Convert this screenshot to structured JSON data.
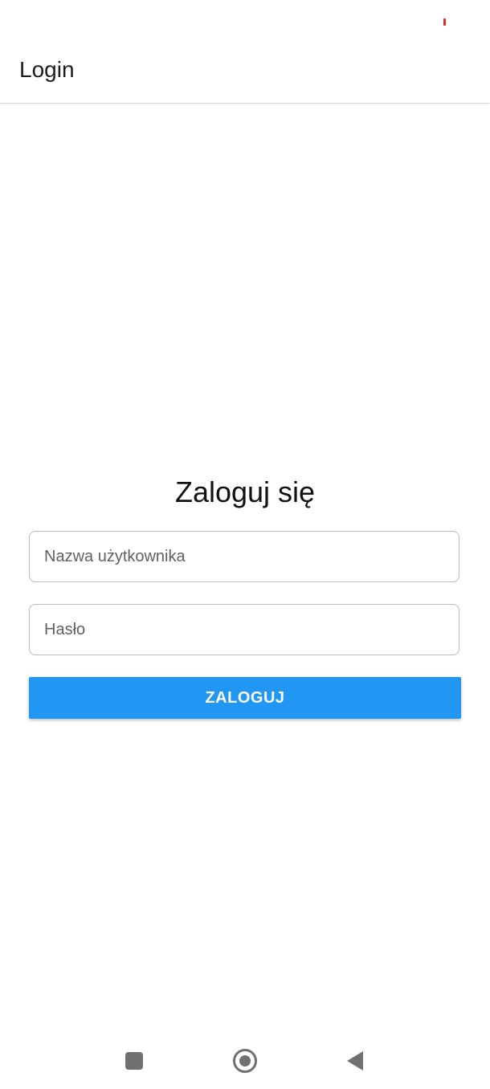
{
  "status_bar": {
    "indicator_color": "#d32f2f"
  },
  "app_bar": {
    "title": "Login"
  },
  "form": {
    "heading": "Zaloguj się",
    "username": {
      "placeholder": "Nazwa użytkownika",
      "value": ""
    },
    "password": {
      "placeholder": "Hasło",
      "value": ""
    },
    "submit_label": "ZALOGUJ",
    "submit_color": "#2196f3"
  },
  "nav_bar": {
    "icons": [
      "recents-icon",
      "home-icon",
      "back-icon"
    ]
  }
}
